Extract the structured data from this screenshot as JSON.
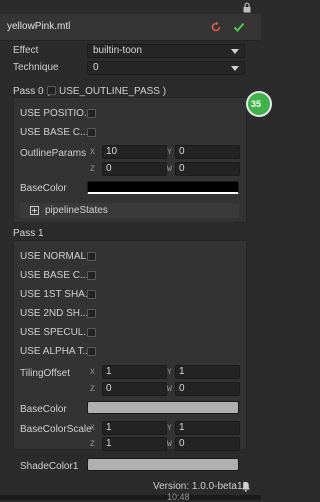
{
  "header": {
    "title": "yellowPink.mtl"
  },
  "effect": {
    "label": "Effect",
    "value": "builtin-toon"
  },
  "technique": {
    "label": "Technique",
    "value": "0"
  },
  "pass0": {
    "title": "Pass 0 (",
    "outline_label": "USE_OUTLINE_PASS )",
    "use_position": "USE POSITIO...",
    "use_base": "USE BASE C...",
    "outline_params": {
      "label": "OutlineParams",
      "x": "10",
      "y": "0",
      "z": "0",
      "w": "0"
    },
    "base_color": {
      "label": "BaseColor",
      "color": "#000000"
    },
    "pipeline_states": "pipelineStates"
  },
  "badge": "35",
  "pass1": {
    "title": "Pass 1",
    "checks": [
      "USE NORMAL...",
      "USE BASE C...",
      "USE 1ST SHA...",
      "USE 2ND SH...",
      "USE SPECUL...",
      "USE ALPHA T..."
    ],
    "tiling_offset": {
      "label": "TilingOffset",
      "x": "1",
      "y": "1",
      "z": "0",
      "w": "0"
    },
    "base_color": {
      "label": "BaseColor",
      "color": "#b0b0b0"
    },
    "base_color_scale": {
      "label": "BaseColorScale",
      "x": "1",
      "y": "1",
      "z": "1",
      "w": "0"
    },
    "shade_color1": {
      "label": "ShadeColor1",
      "color": "#b0b0b0"
    }
  },
  "axes": {
    "x": "X",
    "y": "Y",
    "z": "Z",
    "w": "W"
  },
  "footer": {
    "version": "Version: 1.0.0-beta15"
  },
  "taskbar": {
    "clock": "10:48"
  }
}
